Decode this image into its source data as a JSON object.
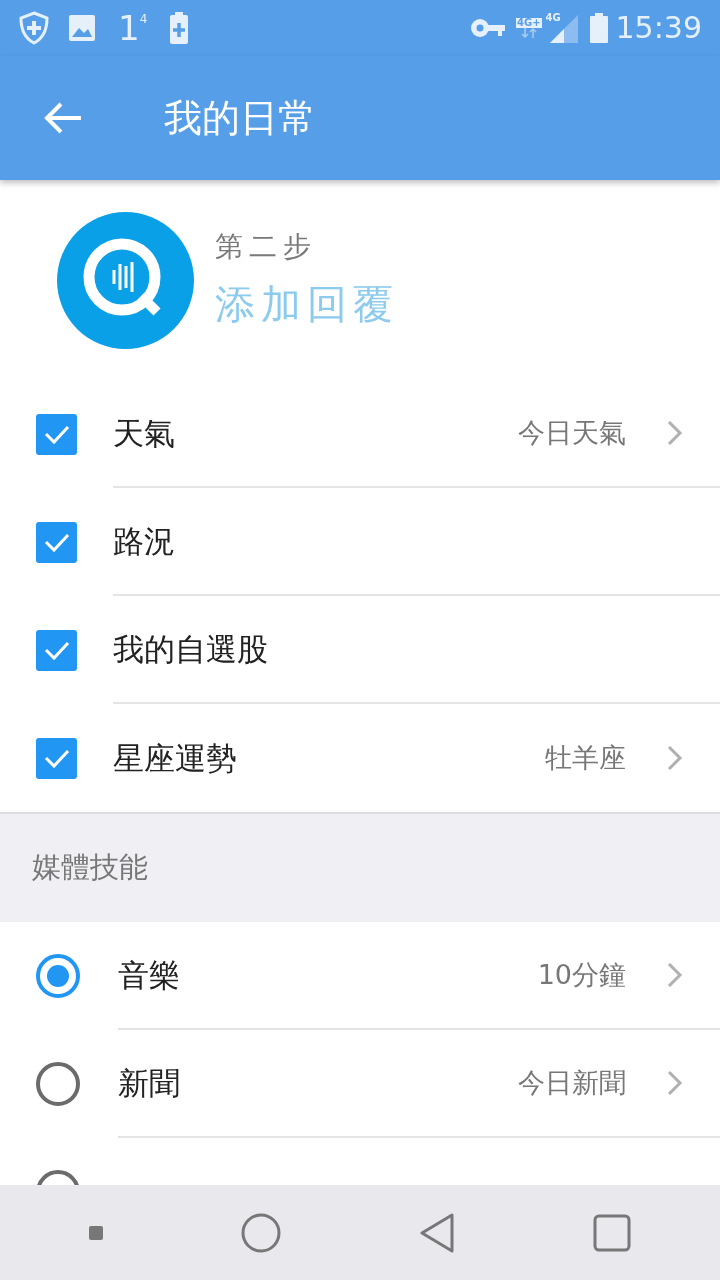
{
  "status_bar": {
    "notification_count": "1",
    "notification_superscript": "4",
    "network_labels": [
      "4G+",
      "4G"
    ],
    "time": "15:39"
  },
  "toolbar": {
    "title": "我的日常"
  },
  "header": {
    "step": "第二步",
    "title": "添加回覆"
  },
  "checklist": [
    {
      "label": "天氣",
      "checked": true,
      "value": "今日天氣",
      "has_chevron": true
    },
    {
      "label": "路況",
      "checked": true,
      "has_chevron": false
    },
    {
      "label": "我的自選股",
      "checked": true,
      "has_chevron": false
    },
    {
      "label": "星座運勢",
      "checked": true,
      "value": "牡羊座",
      "has_chevron": true
    }
  ],
  "section": {
    "title": "媒體技能"
  },
  "media_options": [
    {
      "label": "音樂",
      "selected": true,
      "value": "10分鐘",
      "has_chevron": true
    },
    {
      "label": "新聞",
      "selected": false,
      "value": "今日新聞",
      "has_chevron": true
    },
    {
      "selected": false,
      "has_chevron": false
    }
  ]
}
